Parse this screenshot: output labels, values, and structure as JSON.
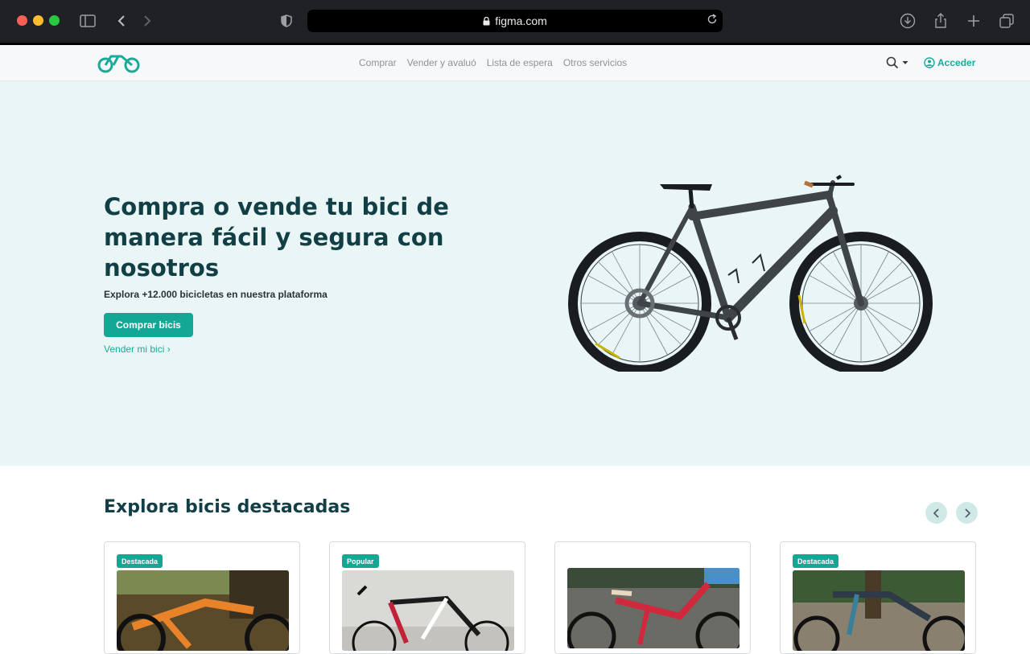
{
  "browser": {
    "url": "figma.com"
  },
  "nav": {
    "links": [
      "Comprar",
      "Vender y avaluó",
      "Lista de espera",
      "Otros servicios"
    ],
    "login_label": "Acceder"
  },
  "hero": {
    "title": "Compra o vende tu bici de manera fácil y segura con nosotros",
    "subtitle": "Explora +12.000 bicicletas en nuestra plataforma",
    "cta_label": "Comprar bicis",
    "secondary_link": "Vender mi bici ›"
  },
  "featured": {
    "title": "Explora bicis destacadas",
    "cards": [
      {
        "badge": "Destacada"
      },
      {
        "badge": "Popular"
      },
      {
        "badge": ""
      },
      {
        "badge": "Destacada"
      }
    ]
  },
  "colors": {
    "brand": "#14a796",
    "hero_bg": "#e9f6f5",
    "heading": "#113f45"
  }
}
